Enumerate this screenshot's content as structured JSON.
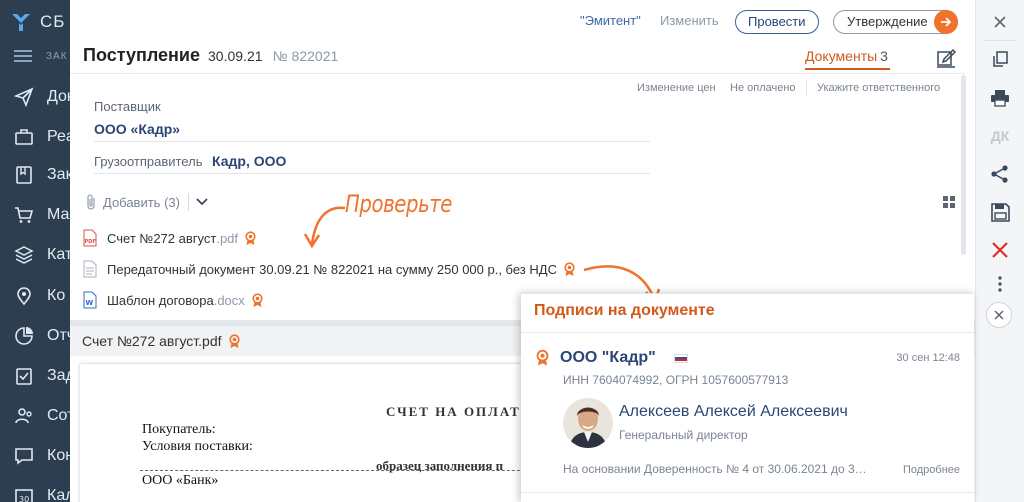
{
  "colors": {
    "accent": "#f0722d",
    "link": "#2a4677",
    "sidebar": "#2c3e50",
    "muted": "#8c99a6"
  },
  "app": {
    "logo_text": "СБ"
  },
  "sidebar": {
    "section_label": "ЗАК",
    "items": [
      {
        "icon": "paper-plane-icon",
        "label": "Док"
      },
      {
        "icon": "briefcase-icon",
        "label": "Реа"
      },
      {
        "icon": "bookmark-icon",
        "label": "Зак"
      },
      {
        "icon": "cart-icon",
        "label": "Ма"
      },
      {
        "icon": "layers-icon",
        "label": "Кат"
      },
      {
        "icon": "location-icon",
        "label": "Ко"
      },
      {
        "icon": "chart-icon",
        "label": "Отч"
      },
      {
        "icon": "task-icon",
        "label": "Зад"
      },
      {
        "icon": "people-icon",
        "label": "Сот"
      },
      {
        "icon": "chat-icon",
        "label": "Кон"
      },
      {
        "icon": "calendar-icon",
        "label": "Кал"
      }
    ]
  },
  "toolbar": {
    "emitent": "\"Эмитент\"",
    "change": "Изменить",
    "post": "Провести",
    "approval": "Утверждение"
  },
  "document": {
    "title": "Поступление",
    "date": "30.09.21",
    "number_label": "№",
    "number": "822021",
    "docs_tab": "Документы",
    "docs_count": "3",
    "meta_price": "Изменение цен",
    "meta_paid": "Не оплачено",
    "meta_responsible": "Укажите ответственного",
    "supplier_label": "Поставщик",
    "supplier": "ООО «Кадр»",
    "shipper_label": "Грузоотправитель",
    "shipper": "Кадр, ООО",
    "add_label": "Добавить (3)",
    "attachments": [
      {
        "name": "Счет №272 август",
        "ext": ".pdf",
        "type": "pdf"
      },
      {
        "name": "Передаточный документ 30.09.21 № 822021 на сумму 250 000 р., без НДС",
        "ext": "",
        "type": "doc"
      },
      {
        "name": "Шаблон договора",
        "ext": ".docx",
        "type": "word"
      }
    ],
    "callout": "Проверьте",
    "preview_title": "Счет №272 август.pdf"
  },
  "paper": {
    "title": "СЧЕТ НА ОПЛАТУ",
    "buyer": "Покупатель:",
    "terms": "Условия поставки:",
    "sample": "образец заполнения п",
    "bank": "ООО «Банк»"
  },
  "right_toolbar": [
    {
      "icon": "close-icon"
    },
    {
      "icon": "copy-icon"
    },
    {
      "icon": "print-icon"
    },
    {
      "icon": "dk-icon",
      "text": "ДК"
    },
    {
      "icon": "share-icon"
    },
    {
      "icon": "save-icon"
    },
    {
      "icon": "delete-icon"
    },
    {
      "icon": "more-icon"
    }
  ],
  "signatures": {
    "title": "Подписи на документе",
    "org": "ООО \"Кадр\"",
    "time": "30 сен 12:48",
    "inn": "ИНН 7604074992, ОГРН 1057600577913",
    "signer": "Алексеев Алексей Алексеевич",
    "position": "Генеральный директор",
    "basis": "На основании Доверенность № 4 от 30.06.2021 до 3…",
    "more": "Подробнее"
  }
}
